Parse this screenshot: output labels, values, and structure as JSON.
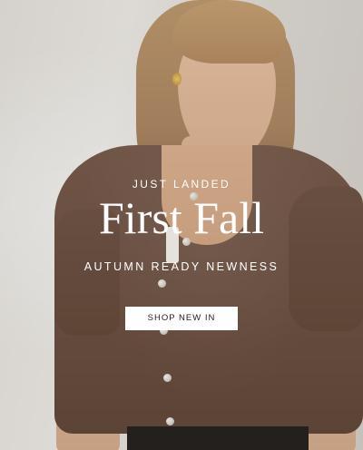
{
  "hero": {
    "eyebrow": "JUST LANDED",
    "headline": "First Fall",
    "subhead": "AUTUMN READY NEWNESS",
    "cta_label": "SHOP NEW IN"
  },
  "colors": {
    "text": "#ffffff",
    "cta_background": "#ffffff",
    "cta_text": "#1f1f1f",
    "cardigan": "#6b5041"
  }
}
